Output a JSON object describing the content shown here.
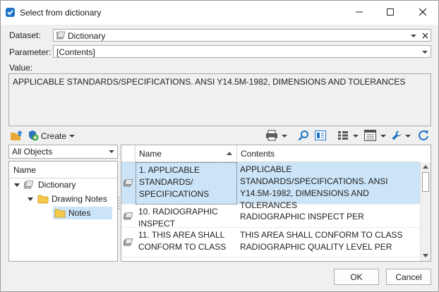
{
  "window": {
    "title": "Select from dictionary",
    "controls": {
      "minimize": "minimize",
      "maximize": "maximize",
      "close": "close"
    }
  },
  "form": {
    "dataset_label": "Dataset:",
    "dataset_value": "Dictionary",
    "parameter_label": "Parameter:",
    "parameter_value": "[Contents]",
    "value_label": "Value:",
    "value_text": "APPLICABLE STANDARDS/SPECIFICATIONS. ANSI Y14.5M-1982, DIMENSIONS AND TOLERANCES"
  },
  "toolbar": {
    "create_label": "Create",
    "icons": [
      "folder-up-icon",
      "create-icon",
      "print-icon",
      "search-icon",
      "preview-icon",
      "list-view-icon",
      "table-view-icon",
      "wrench-icon",
      "refresh-icon"
    ]
  },
  "left_panel": {
    "filter_value": "All Objects",
    "tree_header": "Name",
    "tree_items": [
      {
        "label": "Dictionary",
        "icon": "dictionary-icon",
        "level": 0,
        "expanded": true
      },
      {
        "label": "Drawing Notes",
        "icon": "folder-icon",
        "level": 1,
        "expanded": true
      },
      {
        "label": "Notes",
        "icon": "folder-icon",
        "level": 2,
        "selected": true
      }
    ]
  },
  "grid": {
    "columns": [
      "Name",
      "Contents"
    ],
    "sort_column": "Name",
    "rows": [
      {
        "name": "1. APPLICABLE STANDARDS/ SPECIFICATIONS",
        "contents": "APPLICABLE STANDARDS/SPECIFICATIONS. ANSI Y14.5M-1982, DIMENSIONS AND TOLERANCES",
        "selected": true
      },
      {
        "name": "10. RADIOGRAPHIC INSPECT",
        "contents": "RADIOGRAPHIC INSPECT PER"
      },
      {
        "name": "11. THIS AREA SHALL CONFORM TO CLASS",
        "contents": "THIS AREA SHALL CONFORM TO CLASS RADIOGRAPHIC QUALITY LEVEL PER"
      }
    ]
  },
  "buttons": {
    "ok": "OK",
    "cancel": "Cancel"
  },
  "colors": {
    "selection": "#cce4f7",
    "accent": "#1e73c8",
    "folder": "#f3c94c"
  }
}
